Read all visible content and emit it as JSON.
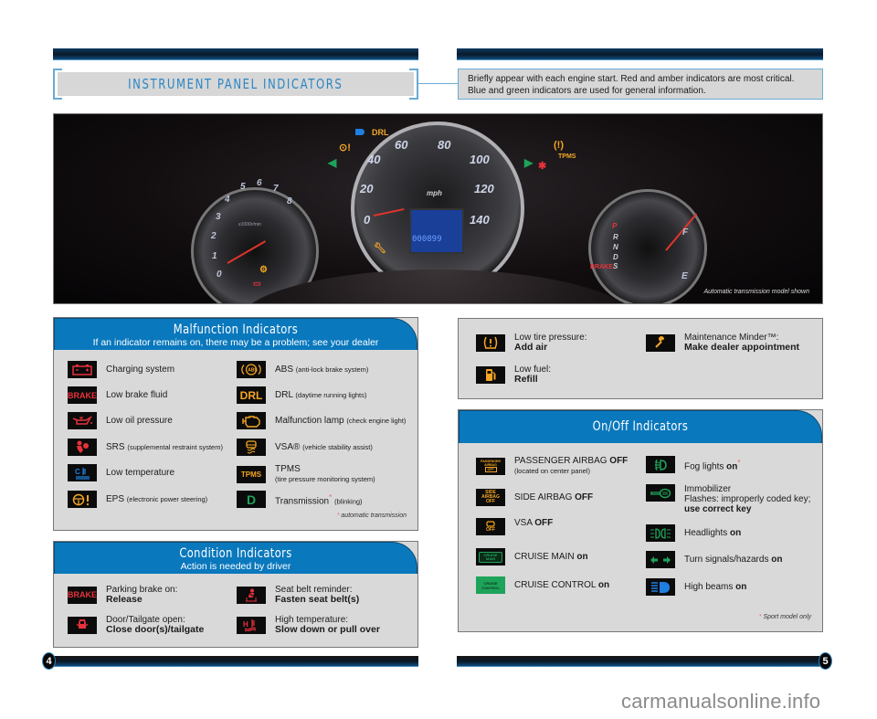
{
  "header": {
    "title": "INSTRUMENT PANEL INDICATORS",
    "intro_line1": "Briefly appear with each engine start. Red and amber indicators are most critical.",
    "intro_line2": "Blue and green indicators are used for general information."
  },
  "photo": {
    "caption": "Automatic transmission model shown",
    "odometer": "000899",
    "speed_unit": "mph",
    "speed_ticks": [
      "0",
      "20",
      "40",
      "60",
      "80",
      "100",
      "120",
      "140"
    ],
    "tach_ticks": [
      "0",
      "1",
      "2",
      "3",
      "4",
      "5",
      "6",
      "7",
      "8"
    ],
    "tach_unit": "x1000r/min",
    "gear_labels": [
      "P",
      "R",
      "N",
      "D",
      "S"
    ],
    "fuel_labels": [
      "F",
      "E"
    ],
    "drl_label": "DRL",
    "tpms_label": "TPMS",
    "brake_label": "BRAKE"
  },
  "malfunction": {
    "title": "Malfunction Indicators",
    "subtitle": "If an indicator remains on, there may be a problem; see your dealer",
    "items": [
      {
        "icon": "battery-icon",
        "label": "Charging system",
        "detail": ""
      },
      {
        "icon": "brake-icon",
        "label": "Low brake fluid",
        "detail": "",
        "glyph": "BRAKE"
      },
      {
        "icon": "oil-can-icon",
        "label": "Low oil pressure",
        "detail": ""
      },
      {
        "icon": "airbag-icon",
        "label": "SRS",
        "detail": "(supplemental restraint system)"
      },
      {
        "icon": "low-temperature-icon",
        "label": "Low temperature",
        "detail": ""
      },
      {
        "icon": "steering-wheel-icon",
        "label": "EPS",
        "detail": "(electronic power steering)"
      },
      {
        "icon": "abs-icon",
        "label": "ABS",
        "detail": "(anti-lock brake system)",
        "glyph": "ABS"
      },
      {
        "icon": "drl-icon",
        "label": "DRL",
        "detail": "(daytime running lights)",
        "glyph": "DRL"
      },
      {
        "icon": "engine-icon",
        "label": "Malfunction lamp",
        "detail": "(check engine light)"
      },
      {
        "icon": "vsa-icon",
        "label": "VSA®",
        "detail": "(vehicle stability assist)"
      },
      {
        "icon": "tpms-icon",
        "label": "TPMS",
        "detail": "(tire pressure monitoring system)",
        "glyph": "TPMS"
      },
      {
        "icon": "transmission-d-icon",
        "label": "Transmission",
        "asterisk": "*",
        "detail": "(blinking)",
        "glyph": "D"
      }
    ],
    "footnote_mark": "*",
    "footnote": "automatic transmission"
  },
  "condition": {
    "title": "Condition Indicators",
    "subtitle": "Action is needed by driver",
    "items": [
      {
        "icon": "parking-brake-icon",
        "line1": "Parking brake on:",
        "line2": "Release",
        "glyph": "BRAKE"
      },
      {
        "icon": "door-open-icon",
        "line1": "Door/Tailgate open:",
        "line2": "Close door(s)/tailgate"
      },
      {
        "icon": "seat-belt-icon",
        "line1": "Seat belt reminder:",
        "line2": "Fasten seat belt(s)"
      },
      {
        "icon": "high-temperature-icon",
        "line1": "High temperature:",
        "line2": "Slow down or pull over"
      }
    ]
  },
  "other": {
    "items": [
      {
        "icon": "tire-pressure-icon",
        "line1": "Low tire pressure:",
        "line2": "Add air"
      },
      {
        "icon": "fuel-pump-icon",
        "line1": "Low fuel:",
        "line2": "Refill"
      },
      {
        "icon": "wrench-icon",
        "line1": "Maintenance Minder™:",
        "line2": "Make dealer appointment"
      }
    ]
  },
  "onoff": {
    "title": "On/Off Indicators",
    "items": [
      {
        "icon": "passenger-airbag-off-icon",
        "label": "PASSENGER AIRBAG",
        "state": "OFF",
        "detail": "(located on center panel)",
        "glyph1": "PASSENGER",
        "glyph2": "AIRBAG",
        "glyph3": "OFF"
      },
      {
        "icon": "side-airbag-off-icon",
        "label": "SIDE AIRBAG",
        "state": "OFF",
        "glyph1": "SIDE",
        "glyph2": "AIRBAG",
        "glyph3": "OFF"
      },
      {
        "icon": "vsa-off-icon",
        "label": "VSA",
        "state": "OFF",
        "glyph": "OFF"
      },
      {
        "icon": "cruise-main-icon",
        "label": "CRUISE MAIN",
        "state": "on",
        "glyph1": "CRUISE",
        "glyph2": "MAIN"
      },
      {
        "icon": "cruise-control-icon",
        "label": "CRUISE CONTROL",
        "state": "on",
        "glyph1": "CRUISE",
        "glyph2": "CONTROL"
      },
      {
        "icon": "fog-light-icon",
        "label": "Fog lights",
        "state": "on",
        "asterisk": "*"
      },
      {
        "icon": "immobilizer-key-icon",
        "label": "Immobilizer",
        "line2": "Flashes: improperly coded key;",
        "line3": "use correct key"
      },
      {
        "icon": "headlights-icon",
        "label": "Headlights",
        "state": "on"
      },
      {
        "icon": "turn-signal-icon",
        "label": "Turn signals/hazards",
        "state": "on"
      },
      {
        "icon": "high-beam-icon",
        "label": "High beams",
        "state": "on"
      }
    ],
    "footnote_mark": "*",
    "footnote": "Sport model only"
  },
  "footer": {
    "page_left": "4",
    "page_right": "5",
    "watermark": "carmanualsonline.info"
  },
  "colors": {
    "accent_blue": "#0a78bd",
    "title_blue": "#2a86c4",
    "panel_gray": "#d9d9d9",
    "indicator_red": "#e8323a",
    "indicator_amber": "#f4a623",
    "indicator_green": "#1ea35a",
    "indicator_blue": "#1e7fe0"
  }
}
